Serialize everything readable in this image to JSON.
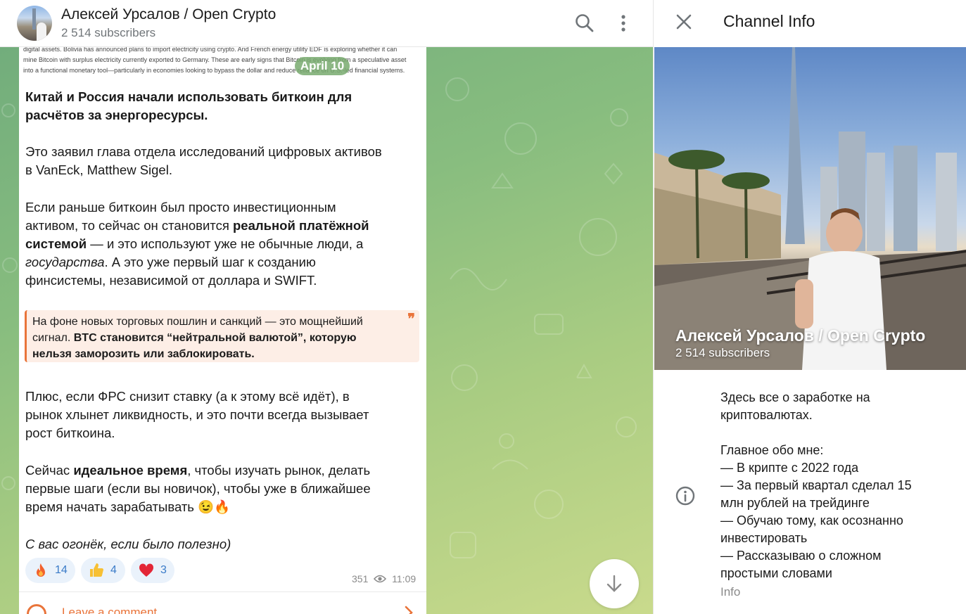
{
  "channel": {
    "title": "Алексей Урсалов / Open Crypto",
    "subscribers": "2 514 subscribers"
  },
  "header_icons": [
    "search-icon",
    "more-vertical-icon"
  ],
  "post": {
    "snippet_lines": [
      "digital assets. Bolivia has announced plans to import electricity using crypto. And French energy utility EDF is exploring whether it can",
      "mine Bitcoin with surplus electricity currently exported to Germany. These are early signs that Bitcoin is evolving from a speculative asset",
      "into a functional monetary tool—particularly in economies looking to bypass the dollar and reduce reliance on U.S.-led financial systems."
    ],
    "date_badge": "April 10",
    "headline_1": "Китай и Россия начали использовать биткоин для",
    "headline_2": "расчётов за энергоресурсы.",
    "para1_line1": "Это заявил глава отдела исследований цифровых активов",
    "para1_line2": "в VanEck, Matthew Sigel.",
    "para2_line1": "Если раньше биткоин был просто инвестиционным",
    "para2_line2a": "активом, то сейчас он становится ",
    "para2_line2b": "реальной платёжной",
    "para2_line3a": "системой",
    "para2_line3b": " — и это используют уже не обычные люди, а",
    "para2_line4a": "государства",
    "para2_line4b": ". А это уже первый шаг к созданию",
    "para2_line5": "финсистемы, независимой от доллара и SWIFT.",
    "quote_line1": "На фоне новых торговых пошлин и санкций — это мощнейший",
    "quote_line2a": "сигнал. ",
    "quote_line2b": "BTC становится “нейтральной валютой”, которую",
    "quote_line3": "нельзя заморозить или заблокировать.",
    "quote_mark": "❞",
    "para3_line1": "Плюс, если ФРС снизит ставку (а к этому всё идёт), в",
    "para3_line2": "рынок хлынет ликвидность, и это почти всегда вызывает",
    "para3_line3": "рост биткоина.",
    "para4_line1a": "Сейчас ",
    "para4_line1b": "идеальное время",
    "para4_line1c": ", чтобы изучать рынок, делать",
    "para4_line2": "первые шаги (если вы новичок), чтобы уже в ближайшее",
    "para4_line3": "время начать зарабатывать 😉🔥",
    "closing": "С вас огонёк, если было полезно)",
    "reactions": [
      {
        "emoji": "fire-icon",
        "count": "14"
      },
      {
        "emoji": "thumbs-up-icon",
        "count": "4"
      },
      {
        "emoji": "heart-icon",
        "count": "3"
      }
    ],
    "views": "351",
    "time": "11:09",
    "comment_label": "Leave a comment"
  },
  "panel": {
    "title": "Channel Info",
    "photo_title": "Алексей Урсалов / Open Crypto",
    "photo_subscribers": "2 514 subscribers",
    "bio_lines": [
      "Здесь все о заработке на",
      "криптовалютах.",
      "",
      "Главное обо мне:",
      "— В крипте с 2022 года",
      "— За первый квартал сделал 15",
      "млн рублей на трейдинге",
      "— Обучаю тому, как осознанно",
      "инвестировать",
      "— Рассказываю о сложном",
      "простыми словами"
    ],
    "info_label": "Info"
  },
  "colors": {
    "accent": "#3a7bc8",
    "orange": "#e9743a",
    "muted": "#707579"
  }
}
